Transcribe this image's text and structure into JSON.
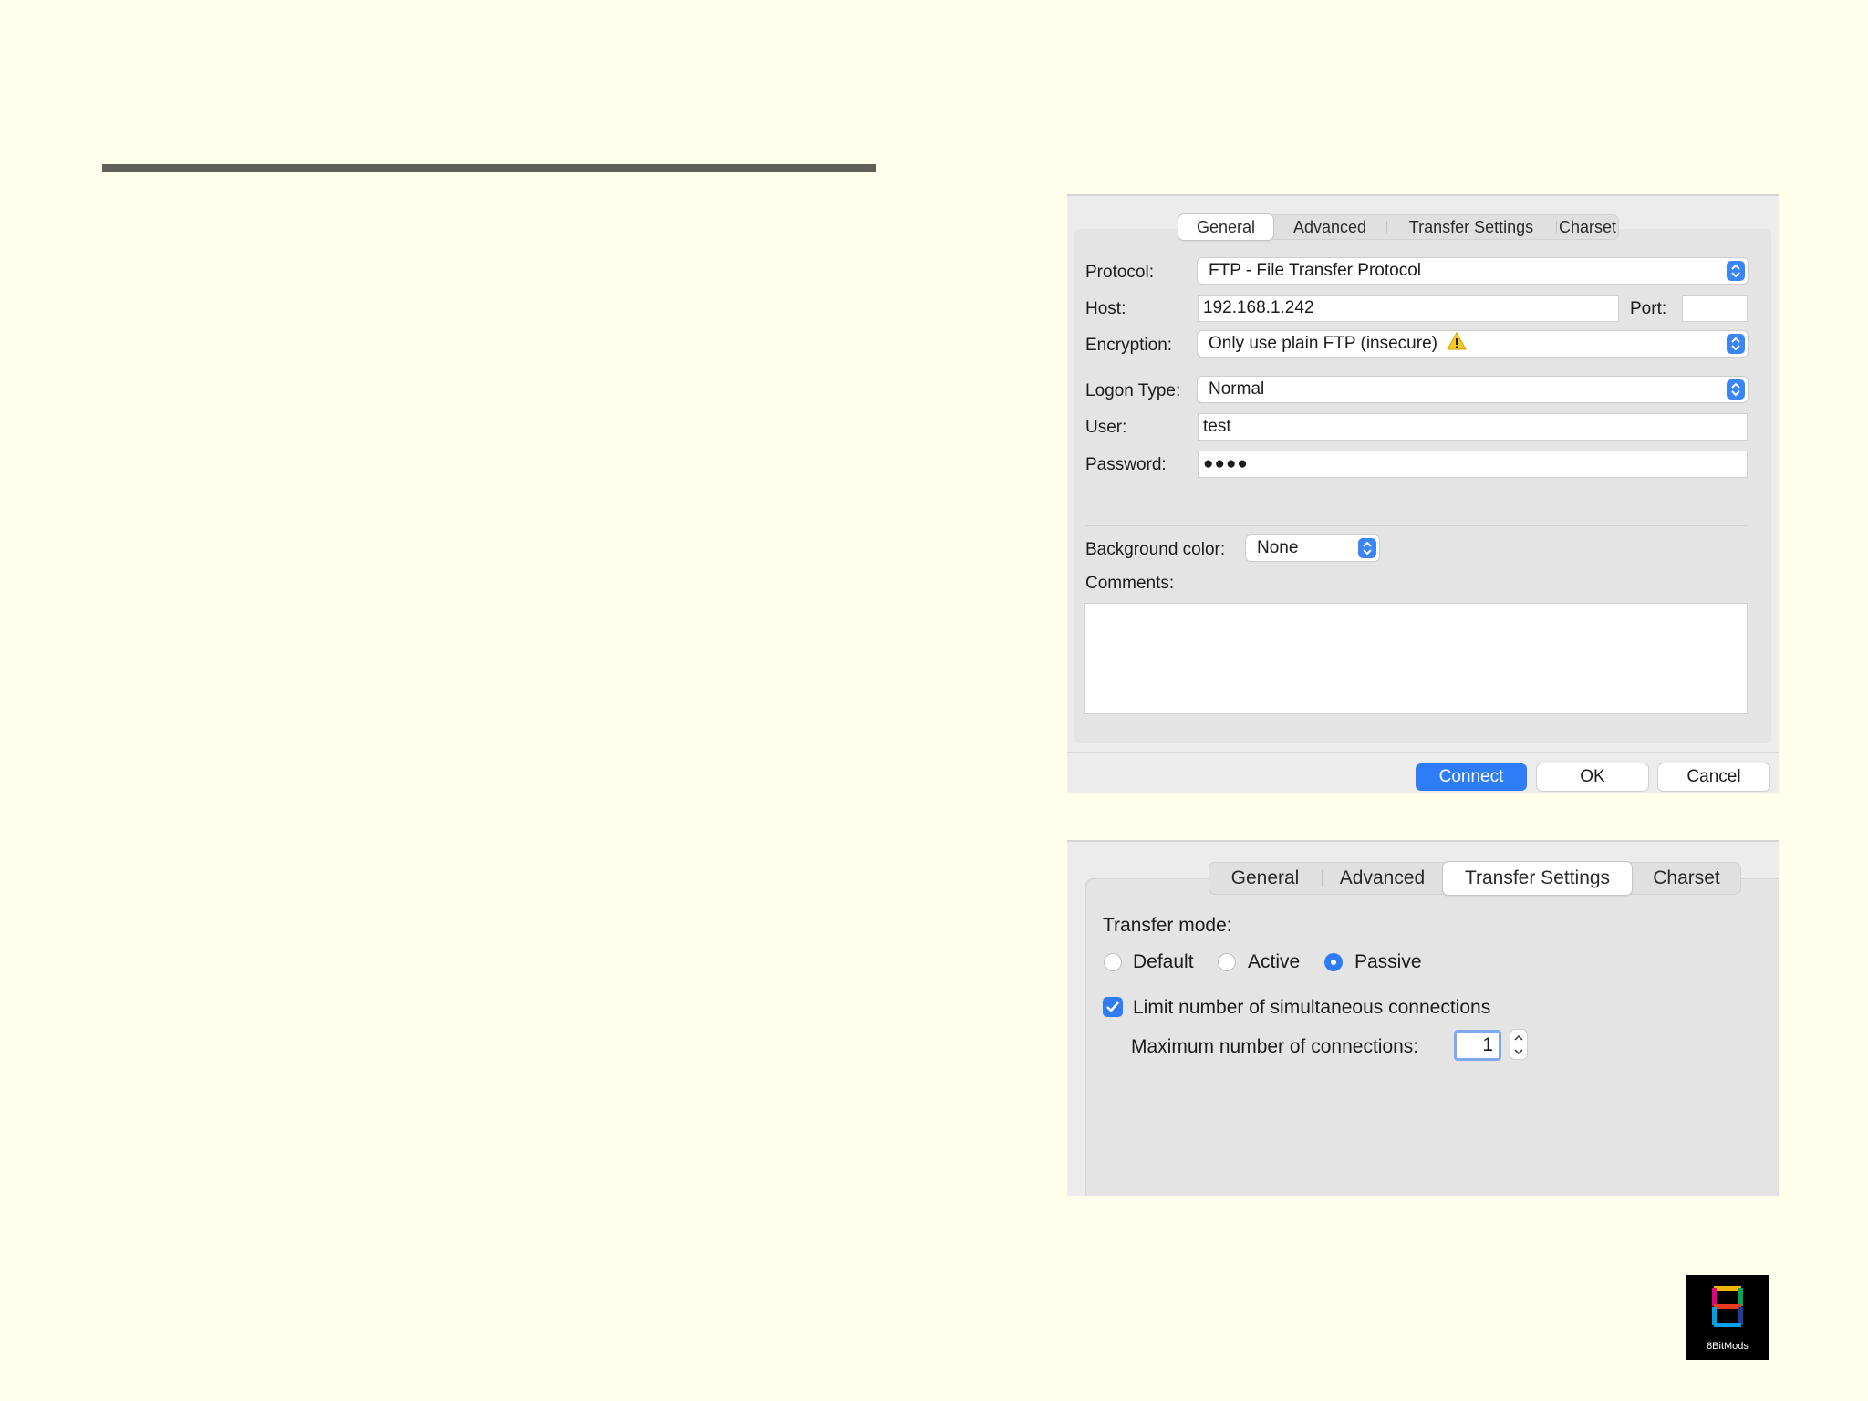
{
  "panel1": {
    "tabs": [
      "General",
      "Advanced",
      "Transfer Settings",
      "Charset"
    ],
    "active_tab": "General",
    "protocol": {
      "label": "Protocol:",
      "value": "FTP - File Transfer Protocol"
    },
    "host": {
      "label": "Host:",
      "value": "192.168.1.242"
    },
    "port": {
      "label": "Port:",
      "value": ""
    },
    "encryption": {
      "label": "Encryption:",
      "value": "Only use plain FTP (insecure)",
      "icon": "warning-icon"
    },
    "logon_type": {
      "label": "Logon Type:",
      "value": "Normal"
    },
    "user": {
      "label": "User:",
      "value": "test"
    },
    "password": {
      "label": "Password:",
      "value": "●●●●"
    },
    "background_color": {
      "label": "Background color:",
      "value": "None"
    },
    "comments": {
      "label": "Comments:",
      "value": ""
    },
    "buttons": {
      "connect": "Connect",
      "ok": "OK",
      "cancel": "Cancel"
    }
  },
  "panel2": {
    "tabs": [
      "General",
      "Advanced",
      "Transfer Settings",
      "Charset"
    ],
    "active_tab": "Transfer Settings",
    "transfer_mode_label": "Transfer mode:",
    "modes": [
      "Default",
      "Active",
      "Passive"
    ],
    "selected_mode": "Passive",
    "limit_label": "Limit number of simultaneous connections",
    "limit_checked": true,
    "max_label": "Maximum number of connections:",
    "max_value": "1"
  },
  "logo": {
    "text": "8BitMods"
  },
  "colors": {
    "accent": "#2e7cf6",
    "page_bg": "#ffffeb",
    "panel_bg": "#ececec"
  }
}
